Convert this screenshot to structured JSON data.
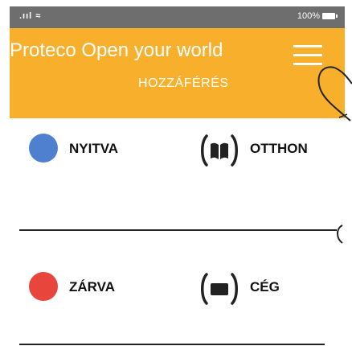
{
  "status_bar": {
    "signal_icon": "signal-wifi-icon",
    "signal_text": ".ııl ≈",
    "battery_text": "100%"
  },
  "header": {
    "app_title": "Proteco Open your world",
    "tab_label": "HOZZÁFÉRÉS",
    "background_color": "#f8b02c"
  },
  "rows": [
    {
      "status": "NYITVA",
      "status_color": "#4f7fcf",
      "mode": "OTTHON",
      "mode_icon": "home-icon"
    },
    {
      "status": "ZÁRVA",
      "status_color": "#e8453c",
      "mode": "CÉG",
      "mode_icon": "office-icon"
    }
  ]
}
